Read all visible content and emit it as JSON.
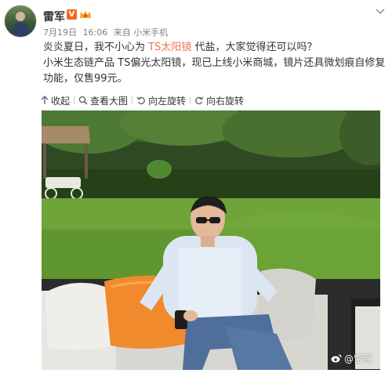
{
  "user": {
    "name": "雷军",
    "vip_badge": "V"
  },
  "meta": {
    "date": "7月19日",
    "time": "16:06",
    "source": "来自 小米手机"
  },
  "post": {
    "line1_pre": "炎炎夏日，我不小心为 ",
    "line1_link": "TS太阳镜",
    "line1_post": " 代盐，大家觉得还可以吗？",
    "line2": "小米生态链产品 TS偏光太阳镜，现已上线小米商城，镜片还具微划痕自修复功能，仅售99元。"
  },
  "toolbar": {
    "collapse": "收起",
    "view_large": "查看大图",
    "rotate_left": "向左旋转",
    "rotate_right": "向右旋转"
  },
  "photo": {
    "watermark": "@雷军"
  }
}
